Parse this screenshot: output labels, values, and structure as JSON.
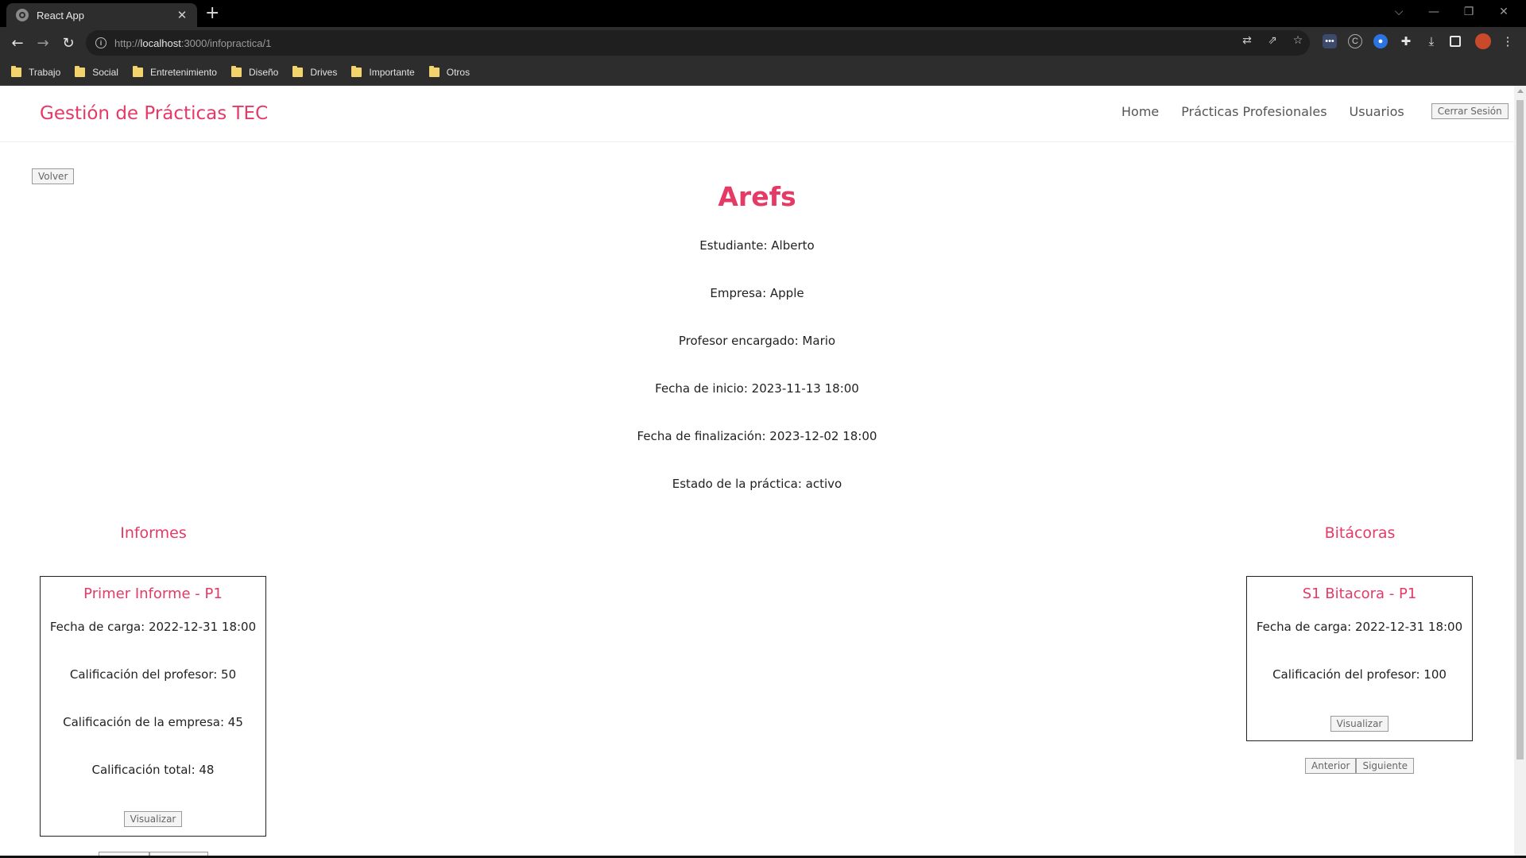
{
  "browser": {
    "tab_title": "React App",
    "tab_close": "✕",
    "new_tab": "+",
    "url_prefix": "http://",
    "url_host": "localhost",
    "url_path": ":3000/infopractica/1",
    "bookmarks": [
      "Trabajo",
      "Social",
      "Entretenimiento",
      "Diseño",
      "Drives",
      "Importante",
      "Otros"
    ]
  },
  "header": {
    "brand": "Gestión de Prácticas TEC",
    "nav": [
      "Home",
      "Prácticas Profesionales",
      "Usuarios"
    ],
    "logout": "Cerrar Sesión"
  },
  "practice": {
    "back": "Volver",
    "title": "Arefs",
    "student": "Estudiante: Alberto",
    "company": "Empresa: Apple",
    "professor": "Profesor encargado: Mario",
    "start": "Fecha de inicio: 2023-11-13 18:00",
    "end": "Fecha de finalización: 2023-12-02 18:00",
    "status": "Estado de la práctica: activo"
  },
  "informes": {
    "heading": "Informes",
    "card": {
      "title": "Primer Informe - P1",
      "upload": "Fecha de carga: 2022-12-31 18:00",
      "prof_grade": "Calificación del profesor: 50",
      "company_grade": "Calificación de la empresa: 45",
      "total_grade": "Calificación total: 48",
      "view": "Visualizar"
    }
  },
  "bitacoras": {
    "heading": "Bitácoras",
    "card": {
      "title": "S1 Bitacora - P1",
      "upload": "Fecha de carga: 2022-12-31 18:00",
      "prof_grade": "Calificación del profesor: 100",
      "view": "Visualizar"
    },
    "prev": "Anterior",
    "next": "Siguiente"
  }
}
